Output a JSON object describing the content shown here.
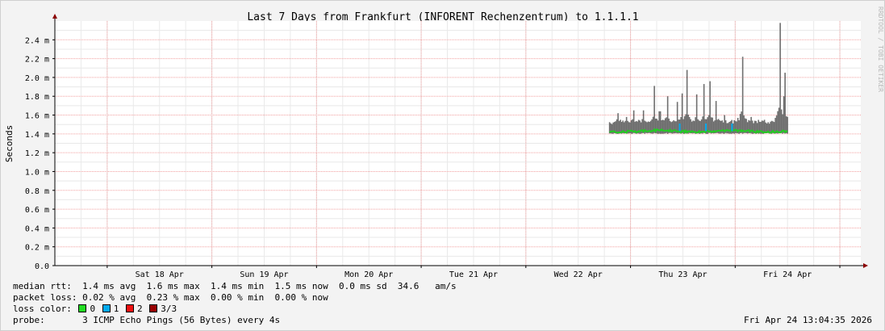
{
  "chart_data": {
    "type": "area",
    "title": "Last 7 Days from Frankfurt (INFORENT Rechenzentrum) to 1.1.1.1",
    "ylabel": "Seconds",
    "xlabel": "",
    "watermark": "RRDTOOL / TOBI OETIKER",
    "ylim": [
      0,
      2.6
    ],
    "y_ticks": [
      {
        "value": 0.0,
        "label": "0.0"
      },
      {
        "value": 0.2,
        "label": "0.2 m"
      },
      {
        "value": 0.4,
        "label": "0.4 m"
      },
      {
        "value": 0.6,
        "label": "0.6 m"
      },
      {
        "value": 0.8,
        "label": "0.8 m"
      },
      {
        "value": 1.0,
        "label": "1.0 m"
      },
      {
        "value": 1.2,
        "label": "1.2 m"
      },
      {
        "value": 1.4,
        "label": "1.4 m"
      },
      {
        "value": 1.6,
        "label": "1.6 m"
      },
      {
        "value": 1.8,
        "label": "1.8 m"
      },
      {
        "value": 2.0,
        "label": "2.0 m"
      },
      {
        "value": 2.2,
        "label": "2.2 m"
      },
      {
        "value": 2.4,
        "label": "2.4 m"
      }
    ],
    "x_range_days": [
      0,
      7.7
    ],
    "x_day_lines": [
      0.5,
      1.5,
      2.5,
      3.5,
      4.5,
      5.5,
      6.5,
      7.5
    ],
    "x_ticks": [
      {
        "day": 1.0,
        "label": "Sat 18 Apr"
      },
      {
        "day": 2.0,
        "label": "Sun 19 Apr"
      },
      {
        "day": 3.0,
        "label": "Mon 20 Apr"
      },
      {
        "day": 4.0,
        "label": "Tue 21 Apr"
      },
      {
        "day": 5.0,
        "label": "Wed 22 Apr"
      },
      {
        "day": 6.0,
        "label": "Thu 23 Apr"
      },
      {
        "day": 7.0,
        "label": "Fri 24 Apr"
      }
    ],
    "series": [
      {
        "name": "median rtt",
        "role": "median",
        "color": "#22cc22"
      },
      {
        "name": "rtt range",
        "role": "smoke",
        "color": "#707070"
      }
    ],
    "data": {
      "start_day": 5.3,
      "end_day": 7.0,
      "median_base": 1.43,
      "smoke_base_top": 1.5,
      "spikes": [
        {
          "day": 5.38,
          "max": 1.62
        },
        {
          "day": 5.46,
          "max": 1.58
        },
        {
          "day": 5.53,
          "max": 1.65
        },
        {
          "day": 5.62,
          "max": 1.65
        },
        {
          "day": 5.73,
          "max": 1.91
        },
        {
          "day": 5.78,
          "max": 1.64
        },
        {
          "day": 5.85,
          "max": 1.8
        },
        {
          "day": 5.95,
          "max": 1.74
        },
        {
          "day": 5.99,
          "max": 1.83
        },
        {
          "day": 6.04,
          "max": 2.08
        },
        {
          "day": 6.13,
          "max": 1.82
        },
        {
          "day": 6.2,
          "max": 1.93
        },
        {
          "day": 6.26,
          "max": 1.96
        },
        {
          "day": 6.32,
          "max": 1.75
        },
        {
          "day": 6.4,
          "max": 1.6
        },
        {
          "day": 6.53,
          "max": 1.57
        },
        {
          "day": 6.57,
          "max": 2.22
        },
        {
          "day": 6.65,
          "max": 1.58
        },
        {
          "day": 6.78,
          "max": 1.55
        },
        {
          "day": 6.88,
          "max": 1.57
        },
        {
          "day": 6.93,
          "max": 2.58
        },
        {
          "day": 6.96,
          "max": 1.8
        },
        {
          "day": 6.98,
          "max": 2.05
        }
      ]
    }
  },
  "legend": {
    "median_rtt": "median rtt:  1.4 ms avg  1.6 ms max  1.4 ms min  1.5 ms now  0.0 ms sd  34.6   am/s",
    "packet_loss": "packet loss: 0.02 % avg  0.23 % max  0.00 % min  0.00 % now",
    "loss_color_label": "loss color:",
    "loss_items": [
      {
        "label": "0",
        "color": "#22dd22"
      },
      {
        "label": "1",
        "color": "#00aaee"
      },
      {
        "label": "2",
        "color": "#ee1111"
      },
      {
        "label": "3/3",
        "color": "#990000"
      }
    ],
    "probe": "probe:       3 ICMP Echo Pings (56 Bytes) every 4s",
    "timestamp": "Fri Apr 24 13:04:35 2026"
  }
}
